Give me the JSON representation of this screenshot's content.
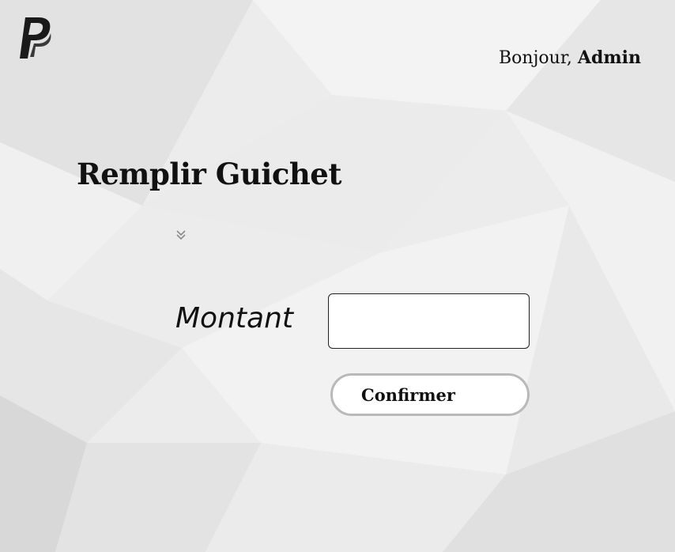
{
  "header": {
    "logo_icon": "paypal-logo-icon",
    "greeting_prefix": "Bonjour, ",
    "user_name": "Admin"
  },
  "main": {
    "title": "Remplir Guichet",
    "scroll_icon": "double-chevron-down-icon",
    "amount_label": "Montant",
    "amount_value": "",
    "amount_placeholder": "",
    "confirm_label": "Confirmer"
  },
  "colors": {
    "background": "#ececec",
    "text": "#111111",
    "button_border": "#b9b9b9",
    "input_border": "#222222"
  }
}
